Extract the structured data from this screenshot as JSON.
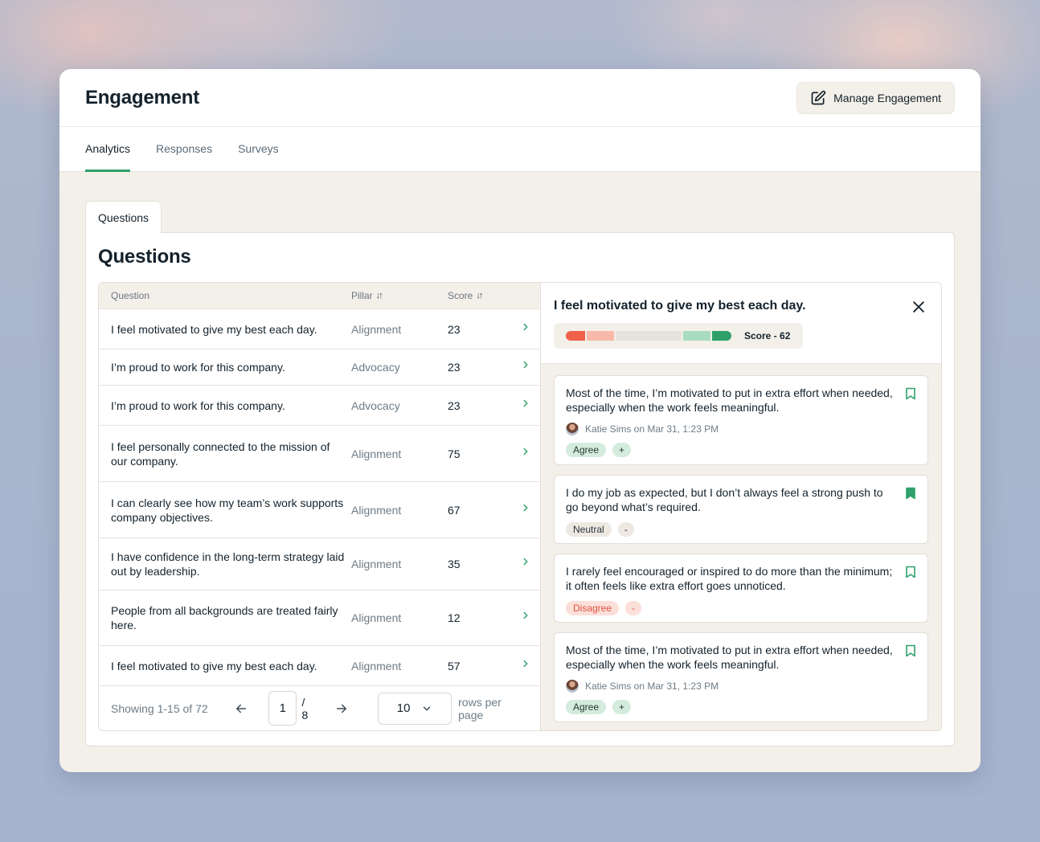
{
  "header": {
    "title": "Engagement",
    "manage_label": "Manage Engagement"
  },
  "tabs": [
    {
      "label": "Analytics",
      "active": true
    },
    {
      "label": "Responses",
      "active": false
    },
    {
      "label": "Surveys",
      "active": false
    }
  ],
  "subtab": {
    "label": "Questions"
  },
  "panel": {
    "title": "Questions"
  },
  "table": {
    "headers": {
      "question": "Question",
      "pillar": "Pillar",
      "score": "Score"
    },
    "rows": [
      {
        "question": "I feel motivated to give my best each day.",
        "pillar": "Alignment",
        "score": "23"
      },
      {
        "question": "I’m proud to work for this company.",
        "pillar": "Advocacy",
        "score": "23"
      },
      {
        "question": "I’m proud to work for this company.",
        "pillar": "Advocacy",
        "score": "23"
      },
      {
        "question": "I feel personally connected to the mission of our company.",
        "pillar": "Alignment",
        "score": "75"
      },
      {
        "question": "I can clearly see how my team’s work supports company objectives.",
        "pillar": "Alignment",
        "score": "67"
      },
      {
        "question": "I have confidence in the long-term strategy laid out by leadership.",
        "pillar": "Alignment",
        "score": "35"
      },
      {
        "question": "People from all backgrounds are treated fairly here.",
        "pillar": "Alignment",
        "score": "12"
      },
      {
        "question": "I feel motivated to give my best each day.",
        "pillar": "Alignment",
        "score": "57"
      }
    ],
    "pagination": {
      "showing": "Showing 1-15 of 72",
      "page": "1",
      "total": "/ 8",
      "rows_per_page": "10",
      "rows_label": "rows per page"
    }
  },
  "detail": {
    "title": "I feel motivated to give my best each day.",
    "score_label": "Score - 62",
    "score_value": 62,
    "score_segments": [
      {
        "color": "#f0614a",
        "fraction": 0.12
      },
      {
        "color": "#f8b9aa",
        "fraction": 0.17
      },
      {
        "color": "#e6e2dc",
        "fraction": 0.41
      },
      {
        "color": "#a8dcc0",
        "fraction": 0.17
      },
      {
        "color": "#2fa06a",
        "fraction": 0.12
      }
    ],
    "responses": [
      {
        "text": "Most of the time, I’m motivated to put in extra effort when needed, especially when the work feels meaningful.",
        "author": "Katie Sims on Mar 31, 1:23 PM",
        "tag": "Agree",
        "tag_type": "agree",
        "extra": "+",
        "bookmarked": false
      },
      {
        "text": "I do my job as expected, but I don’t always feel a strong push to go beyond what’s required.",
        "author": "",
        "tag": "Neutral",
        "tag_type": "neutral",
        "extra": "-",
        "bookmarked": true
      },
      {
        "text": "I rarely feel encouraged or inspired to do more than the minimum; it often feels like extra effort goes unnoticed.",
        "author": "",
        "tag": "Disagree",
        "tag_type": "disagree",
        "extra": "-",
        "bookmarked": false
      },
      {
        "text": "Most of the time, I’m motivated to put in extra effort when needed, especially when the work feels meaningful.",
        "author": "Katie Sims on Mar 31, 1:23 PM",
        "tag": "Agree",
        "tag_type": "agree",
        "extra": "+",
        "bookmarked": false
      }
    ]
  },
  "colors": {
    "accent": "#2fa06a",
    "negative": "#e0533f"
  }
}
